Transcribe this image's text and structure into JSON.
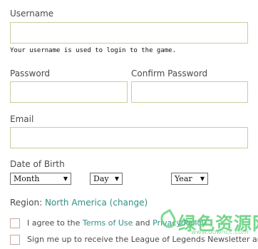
{
  "username": {
    "label": "Username",
    "value": "",
    "hint": "Your username is used to login to the game."
  },
  "password": {
    "label": "Password",
    "value": ""
  },
  "confirm_password": {
    "label": "Confirm Password",
    "value": ""
  },
  "email": {
    "label": "Email",
    "value": ""
  },
  "dob": {
    "label": "Date of Birth",
    "month": "Month",
    "day": "Day",
    "year": "Year"
  },
  "region": {
    "prefix": "Region:",
    "value": "North America",
    "change_label": "(change)"
  },
  "terms": {
    "text_before": "I agree to the ",
    "terms_link": "Terms of Use",
    "middle": " and ",
    "privacy_link": "Privacy Policy",
    "checked": false
  },
  "newsletter": {
    "text": "Sign me up to receive the League of Legends Newsletter and",
    "checked": false
  },
  "watermark": {
    "title": "绿色资源网",
    "url": "www.downcc.com"
  },
  "colors": {
    "field_border": "#c9cd9e",
    "link": "#2f8f86",
    "checkbox_border": "#c7a9a1",
    "watermark": "#5fcf78"
  },
  "icons": [
    "dropdown-caret-icon",
    "watermark-leaf-icon"
  ]
}
